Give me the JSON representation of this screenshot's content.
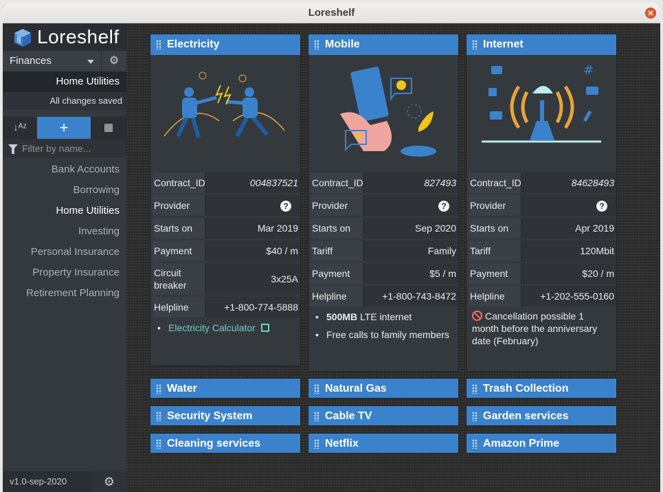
{
  "window": {
    "title": "Loreshelf"
  },
  "sidebar": {
    "logo_text": "Loreshelf",
    "category": "Finances",
    "current_page": "Home Utilities",
    "save_status": "All changes saved",
    "filter_placeholder": "Filter by name...",
    "pages": [
      "Bank Accounts",
      "Borrowing",
      "Home Utilities",
      "Investing",
      "Personal Insurance",
      "Property Insurance",
      "Retirement Planning"
    ],
    "active_page": "Home Utilities",
    "version": "v1.0-sep-2020"
  },
  "cards": {
    "electricity": {
      "title": "Electricity",
      "rows": [
        {
          "key": "Contract_ID",
          "value": "004837521"
        },
        {
          "key": "Provider",
          "value": "?"
        },
        {
          "key": "Starts on",
          "value": "Mar 2019"
        },
        {
          "key": "Payment",
          "value": "$40 / m"
        },
        {
          "key": "Circuit breaker",
          "value": "3x25A"
        },
        {
          "key": "Helpline",
          "value": "+1-800-774-5888"
        }
      ],
      "link": "Electricity Calculator"
    },
    "mobile": {
      "title": "Mobile",
      "rows": [
        {
          "key": "Contract_ID",
          "value": "827493"
        },
        {
          "key": "Provider",
          "value": "?"
        },
        {
          "key": "Starts on",
          "value": "Sep 2020"
        },
        {
          "key": "Tariff",
          "value": "Family"
        },
        {
          "key": "Payment",
          "value": "$5 / m"
        },
        {
          "key": "Helpline",
          "value": "+1-800-743-8472"
        }
      ],
      "notes": [
        {
          "bold": "500MB",
          "text": " LTE internet"
        },
        {
          "bold": "",
          "text": "Free calls to family members"
        }
      ]
    },
    "internet": {
      "title": "Internet",
      "rows": [
        {
          "key": "Contract_ID",
          "value": "84628493"
        },
        {
          "key": "Provider",
          "value": "?"
        },
        {
          "key": "Starts on",
          "value": "Apr 2019"
        },
        {
          "key": "Tariff",
          "value": "120Mbit"
        },
        {
          "key": "Payment",
          "value": "$20 / m"
        },
        {
          "key": "Helpline",
          "value": "+1-202-555-0160"
        }
      ],
      "note": "Cancellation possible 1 month before the anniversary date (February)"
    }
  },
  "collapsed_cards": [
    "Water",
    "Natural Gas",
    "Trash Collection",
    "Security System",
    "Cable TV",
    "Garden services",
    "Cleaning services",
    "Netflix",
    "Amazon Prime"
  ],
  "colors": {
    "accent": "#3b82cc",
    "link": "#6ed0c8",
    "warning": "#ff6b6b"
  }
}
